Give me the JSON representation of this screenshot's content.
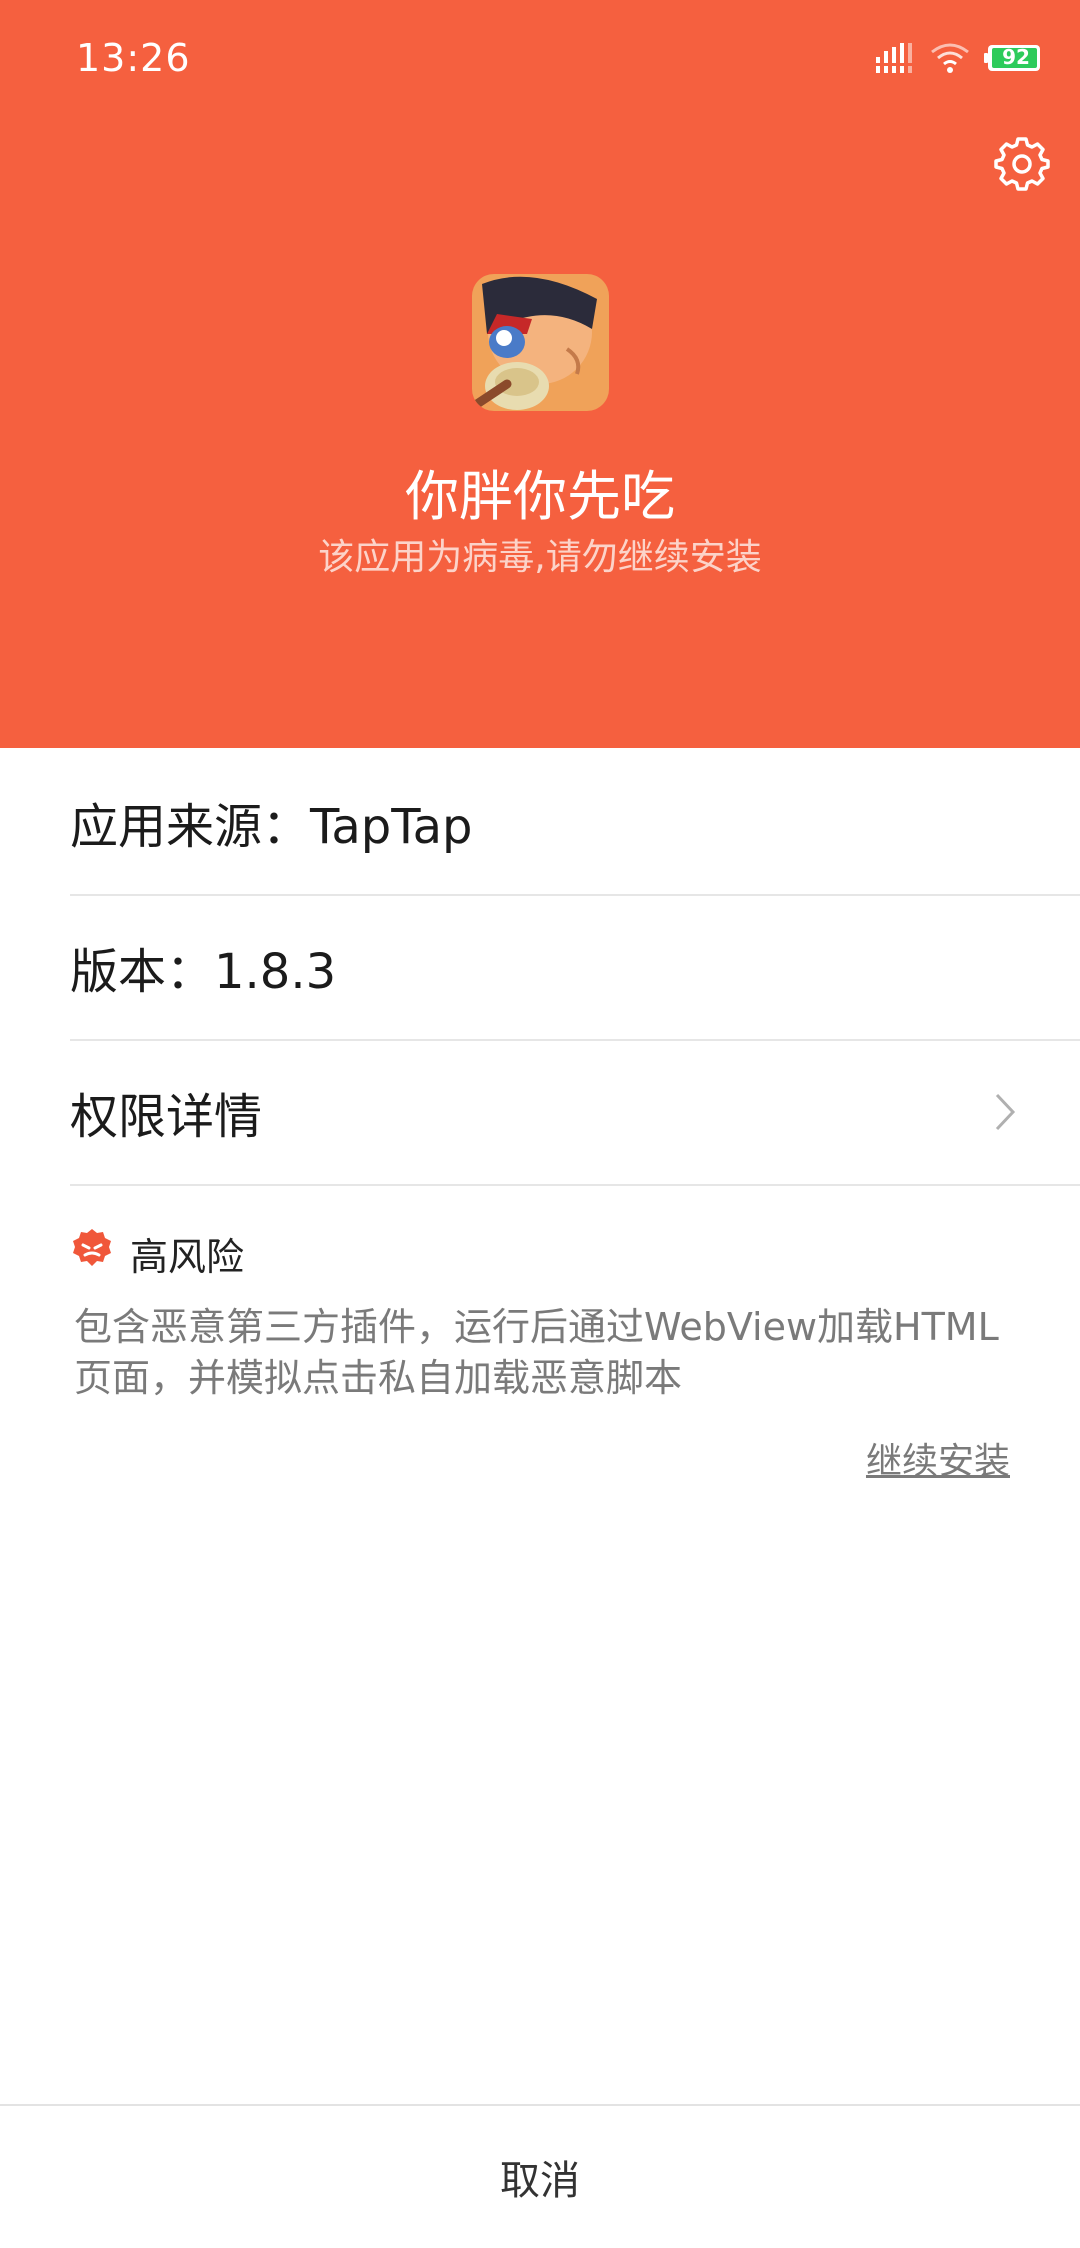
{
  "status_bar": {
    "time": "13:26",
    "battery": "92",
    "icons": [
      "signal-icon",
      "wifi-icon",
      "battery-icon"
    ]
  },
  "header": {
    "settings_icon": "gear-icon",
    "app_name": "你胖你先吃",
    "warning": "该应用为病毒,请勿继续安装",
    "background_color": "#F5603F"
  },
  "details": {
    "source": "应用来源：TapTap",
    "version": "版本：1.8.3",
    "permissions": "权限详情"
  },
  "risk": {
    "level": "高风险",
    "description": "包含恶意第三方插件，运行后通过WebView加载HTML页面，并模拟点击私自加载恶意脚本",
    "continue_label": "继续安装",
    "badge_color": "#F0573A"
  },
  "footer": {
    "cancel_label": "取消"
  }
}
